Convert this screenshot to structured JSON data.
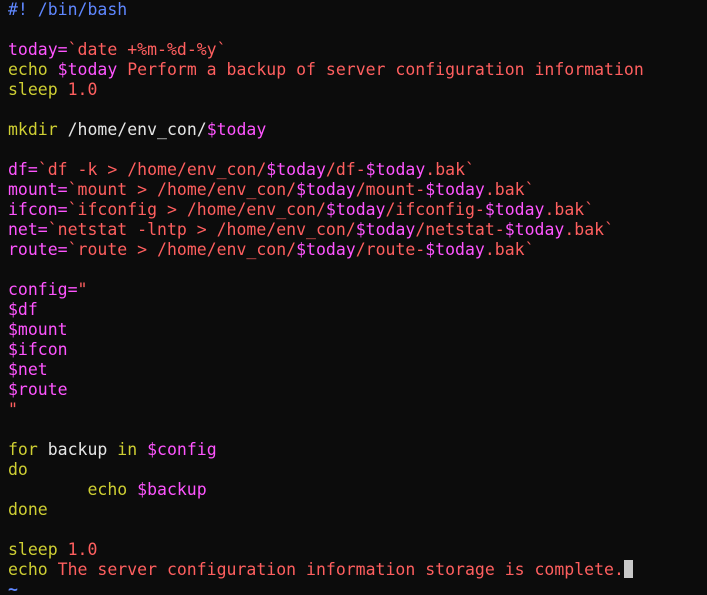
{
  "editor": {
    "lines": [
      [
        {
          "text": "#! /bin/bash",
          "color": "blue"
        }
      ],
      [],
      [
        {
          "text": "today=",
          "color": "magenta"
        },
        {
          "text": "`date +%m-%d-%y`",
          "color": "red"
        }
      ],
      [
        {
          "text": "echo ",
          "color": "yellow"
        },
        {
          "text": "$today",
          "color": "magenta"
        },
        {
          "text": " Perform a backup of server configuration information",
          "color": "red"
        }
      ],
      [
        {
          "text": "sleep ",
          "color": "yellow"
        },
        {
          "text": "1.0",
          "color": "red"
        }
      ],
      [],
      [
        {
          "text": "mkdir ",
          "color": "yellow"
        },
        {
          "text": "/home/env_con/",
          "color": "white"
        },
        {
          "text": "$today",
          "color": "magenta"
        }
      ],
      [],
      [
        {
          "text": "df=",
          "color": "magenta"
        },
        {
          "text": "`df -k > /home/env_con/",
          "color": "red"
        },
        {
          "text": "$today",
          "color": "magenta"
        },
        {
          "text": "/df-",
          "color": "red"
        },
        {
          "text": "$today",
          "color": "magenta"
        },
        {
          "text": ".bak`",
          "color": "red"
        }
      ],
      [
        {
          "text": "mount=",
          "color": "magenta"
        },
        {
          "text": "`mount > /home/env_con/",
          "color": "red"
        },
        {
          "text": "$today",
          "color": "magenta"
        },
        {
          "text": "/mount-",
          "color": "red"
        },
        {
          "text": "$today",
          "color": "magenta"
        },
        {
          "text": ".bak`",
          "color": "red"
        }
      ],
      [
        {
          "text": "ifcon=",
          "color": "magenta"
        },
        {
          "text": "`ifconfig > /home/env_con/",
          "color": "red"
        },
        {
          "text": "$today",
          "color": "magenta"
        },
        {
          "text": "/ifconfig-",
          "color": "red"
        },
        {
          "text": "$today",
          "color": "magenta"
        },
        {
          "text": ".bak`",
          "color": "red"
        }
      ],
      [
        {
          "text": "net=",
          "color": "magenta"
        },
        {
          "text": "`netstat -lntp > /home/env_con/",
          "color": "red"
        },
        {
          "text": "$today",
          "color": "magenta"
        },
        {
          "text": "/netstat-",
          "color": "red"
        },
        {
          "text": "$today",
          "color": "magenta"
        },
        {
          "text": ".bak`",
          "color": "red"
        }
      ],
      [
        {
          "text": "route=",
          "color": "magenta"
        },
        {
          "text": "`route > /home/env_con/",
          "color": "red"
        },
        {
          "text": "$today",
          "color": "magenta"
        },
        {
          "text": "/route-",
          "color": "red"
        },
        {
          "text": "$today",
          "color": "magenta"
        },
        {
          "text": ".bak`",
          "color": "red"
        }
      ],
      [],
      [
        {
          "text": "config=",
          "color": "magenta"
        },
        {
          "text": "\"",
          "color": "red"
        }
      ],
      [
        {
          "text": "$df",
          "color": "magenta"
        }
      ],
      [
        {
          "text": "$mount",
          "color": "magenta"
        }
      ],
      [
        {
          "text": "$ifcon",
          "color": "magenta"
        }
      ],
      [
        {
          "text": "$net",
          "color": "magenta"
        }
      ],
      [
        {
          "text": "$route",
          "color": "magenta"
        }
      ],
      [
        {
          "text": "\"",
          "color": "red"
        }
      ],
      [],
      [
        {
          "text": "for ",
          "color": "yellow"
        },
        {
          "text": "backup ",
          "color": "white"
        },
        {
          "text": "in ",
          "color": "yellow"
        },
        {
          "text": "$config",
          "color": "magenta"
        }
      ],
      [
        {
          "text": "do",
          "color": "yellow"
        }
      ],
      [
        {
          "text": "        echo ",
          "color": "yellow"
        },
        {
          "text": "$backup",
          "color": "magenta"
        }
      ],
      [
        {
          "text": "done",
          "color": "yellow"
        }
      ],
      [],
      [
        {
          "text": "sleep ",
          "color": "yellow"
        },
        {
          "text": "1.0",
          "color": "red"
        }
      ],
      [
        {
          "text": "echo ",
          "color": "yellow"
        },
        {
          "text": "The server configuration information storage is complete.",
          "color": "red"
        },
        {
          "text": "",
          "color": "cursor"
        }
      ],
      [
        {
          "text": "~",
          "color": "tilde"
        }
      ]
    ]
  },
  "colors": {
    "background": "#0c0c0c",
    "magenta": "#ff55ff",
    "yellow": "#cfcf33",
    "red": "#ff5f5f",
    "white": "#e6e6e6",
    "blue": "#5f87ff",
    "cursor": "#c8c8c8"
  }
}
